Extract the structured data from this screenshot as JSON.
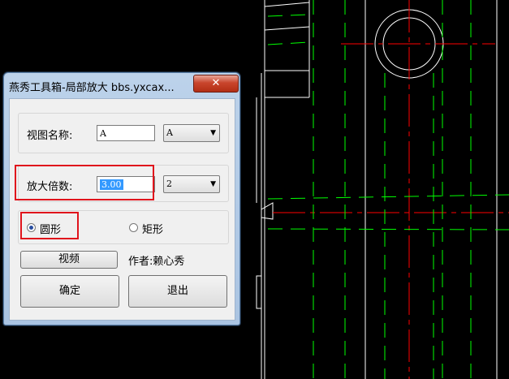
{
  "dialog": {
    "title": "燕秀工具箱-局部放大  bbs.yxcax...",
    "close_glyph": "✕",
    "view_name_label": "视图名称:",
    "view_name_value": "A",
    "view_combo_value": "A",
    "scale_label": "放大倍数:",
    "scale_value": "3.00",
    "scale_combo_value": "2",
    "shape_options": [
      {
        "label": "圆形",
        "checked": true
      },
      {
        "label": "矩形",
        "checked": false
      }
    ],
    "video_button": "视频",
    "author_text": "作者:赖心秀",
    "ok_button": "确定",
    "exit_button": "退出"
  },
  "colors": {
    "cad_background": "#000000",
    "cad_lines": "#ffffff",
    "cad_center_lines": "#ff0000",
    "cad_hidden_lines": "#00ff00",
    "highlight": "#e0141c"
  },
  "icons": [
    "close-icon",
    "dropdown-arrow-icon",
    "radio-icon"
  ]
}
